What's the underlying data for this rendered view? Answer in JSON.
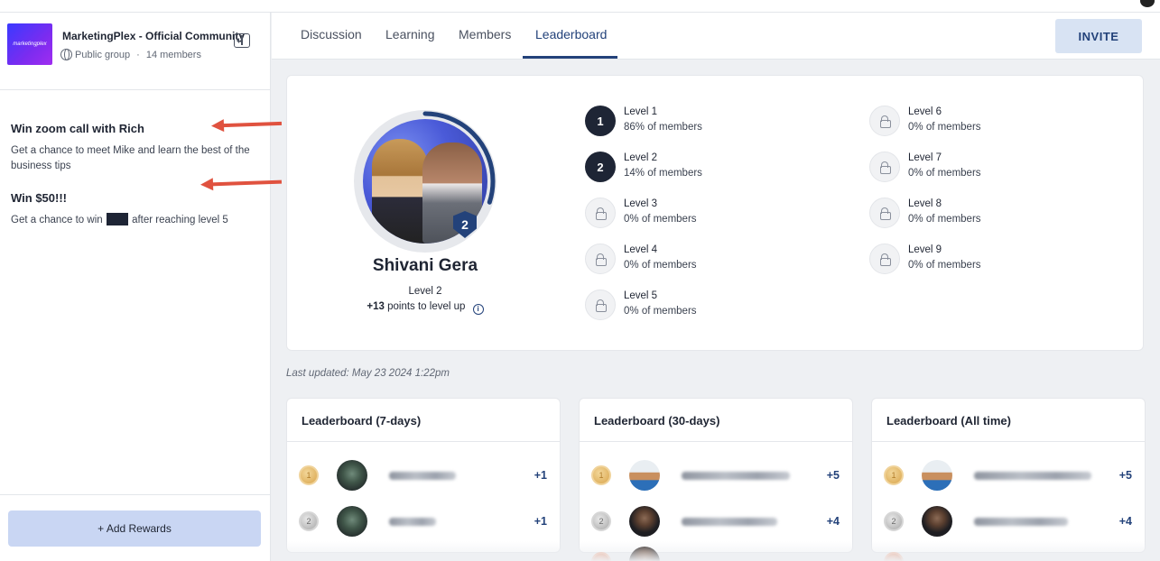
{
  "group": {
    "logo_text": "marketingplex",
    "name": "MarketingPlex - Official Community",
    "privacy": "Public group",
    "separator": "·",
    "members": "14 members"
  },
  "rewards": [
    {
      "title": "Win zoom call with Rich",
      "description": "Get a chance to meet Mike and learn the best of the business tips"
    },
    {
      "title": "Win $50!!!",
      "description_before": "Get a chance to win",
      "description_after": "after reaching level 5"
    }
  ],
  "sidebar": {
    "add_rewards_label": "+ Add Rewards"
  },
  "nav": {
    "tabs": [
      {
        "label": "Discussion",
        "active": false
      },
      {
        "label": "Learning",
        "active": false
      },
      {
        "label": "Members",
        "active": false
      },
      {
        "label": "Leaderboard",
        "active": true
      }
    ],
    "invite_label": "INVITE"
  },
  "profile": {
    "name": "Shivani Gera",
    "level_label": "Level 2",
    "level_badge": "2",
    "points_value": "+13",
    "points_text": "points to level up",
    "progress_fraction": 0.3
  },
  "levels": [
    {
      "name": "Level 1",
      "pct": "86% of members",
      "locked": false,
      "number": "1"
    },
    {
      "name": "Level 2",
      "pct": "14% of members",
      "locked": false,
      "number": "2"
    },
    {
      "name": "Level 3",
      "pct": "0% of members",
      "locked": true
    },
    {
      "name": "Level 4",
      "pct": "0% of members",
      "locked": true
    },
    {
      "name": "Level 5",
      "pct": "0% of members",
      "locked": true
    },
    {
      "name": "Level 6",
      "pct": "0% of members",
      "locked": true
    },
    {
      "name": "Level 7",
      "pct": "0% of members",
      "locked": true
    },
    {
      "name": "Level 8",
      "pct": "0% of members",
      "locked": true
    },
    {
      "name": "Level 9",
      "pct": "0% of members",
      "locked": true
    }
  ],
  "last_updated": "Last updated: May 23 2024 1:22pm",
  "leaderboards": [
    {
      "title": "Leaderboard (7-days)",
      "rows": [
        {
          "rank": "1",
          "points": "+1"
        },
        {
          "rank": "2",
          "points": "+1"
        }
      ]
    },
    {
      "title": "Leaderboard (30-days)",
      "rows": [
        {
          "rank": "1",
          "points": "+5"
        },
        {
          "rank": "2",
          "points": "+4"
        }
      ]
    },
    {
      "title": "Leaderboard (All time)",
      "rows": [
        {
          "rank": "1",
          "points": "+5"
        },
        {
          "rank": "2",
          "points": "+4"
        }
      ]
    }
  ],
  "colors": {
    "accent": "#23427a",
    "annotation_arrow": "#e0523f",
    "invite_bg": "#d8e3f3",
    "add_rewards_bg": "#c9d6f3"
  }
}
